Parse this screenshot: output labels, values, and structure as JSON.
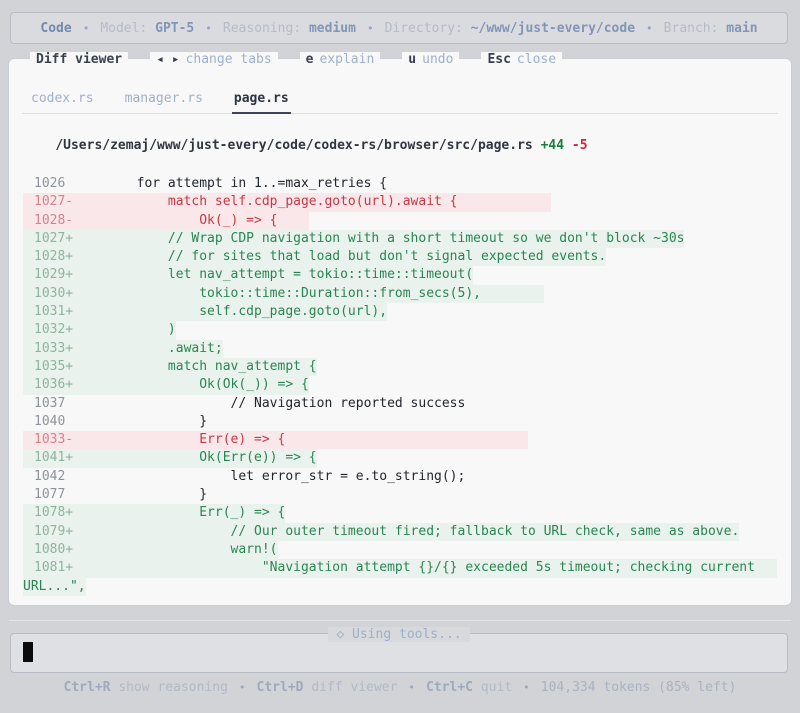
{
  "topbar": {
    "app": "Code",
    "separator": "•",
    "items": [
      {
        "label": "Model: ",
        "value": "GPT-5"
      },
      {
        "label": "Reasoning: ",
        "value": "medium"
      },
      {
        "label": "Directory: ",
        "value": "~/www/just-every/code"
      },
      {
        "label": "Branch: ",
        "value": "main"
      }
    ]
  },
  "diff_viewer": {
    "title": "Diff viewer",
    "shortcuts": [
      {
        "key": "◂ ▸",
        "action": "change tabs"
      },
      {
        "key": "e",
        "action": "explain"
      },
      {
        "key": "u",
        "action": "undo"
      },
      {
        "key": "Esc",
        "action": "close"
      }
    ],
    "tabs": [
      {
        "label": "codex.rs",
        "active": false
      },
      {
        "label": "manager.rs",
        "active": false
      },
      {
        "label": "page.rs",
        "active": true
      }
    ],
    "file": {
      "path": "/Users/zemaj/www/just-every/code/codex-rs/browser/src/page.rs",
      "additions": "+44",
      "deletions": "-5"
    },
    "lines": [
      {
        "num": "1026",
        "type": "context",
        "text": "        for attempt in 1..=max_retries {"
      },
      {
        "num": "1027-",
        "type": "removed",
        "text": "            match self.cdp_page.goto(url).await {            "
      },
      {
        "num": "1028-",
        "type": "removed",
        "text": "                Ok(_) => {    "
      },
      {
        "num": "1027+",
        "type": "added",
        "text": "            // Wrap CDP navigation with a short timeout so we don't block ~30s"
      },
      {
        "num": "1028+",
        "type": "added",
        "text": "            // for sites that load but don't signal expected events."
      },
      {
        "num": "1029+",
        "type": "added",
        "text": "            let nav_attempt = tokio::time::timeout("
      },
      {
        "num": "1030+",
        "type": "added",
        "text": "                tokio::time::Duration::from_secs(5),        "
      },
      {
        "num": "1031+",
        "type": "added",
        "text": "                self.cdp_page.goto(url),"
      },
      {
        "num": "1032+",
        "type": "added",
        "text": "            )"
      },
      {
        "num": "1033+",
        "type": "added",
        "text": "            .await;"
      },
      {
        "num": "1035+",
        "type": "added",
        "text": "            match nav_attempt {"
      },
      {
        "num": "1036+",
        "type": "added",
        "text": "                Ok(Ok(_)) => {"
      },
      {
        "num": "1037",
        "type": "context",
        "text": "                    // Navigation reported success"
      },
      {
        "num": "1040",
        "type": "context",
        "text": "                }"
      },
      {
        "num": "1033-",
        "type": "removed",
        "text": "                Err(e) => {                               "
      },
      {
        "num": "1041+",
        "type": "added",
        "text": "                Ok(Err(e)) => {"
      },
      {
        "num": "1042",
        "type": "context",
        "text": "                    let error_str = e.to_string();"
      },
      {
        "num": "1077",
        "type": "context",
        "text": "                }"
      },
      {
        "num": "1078+",
        "type": "added",
        "text": "                Err(_) => {"
      },
      {
        "num": "1079+",
        "type": "added",
        "text": "                    // Our outer timeout fired; fallback to URL check, same as above."
      },
      {
        "num": "1080+",
        "type": "added",
        "text": "                    warn!("
      },
      {
        "num": "1081+",
        "type": "added",
        "text": "                        \"Navigation attempt {}/{} exceeded 5s timeout; checking current",
        "wide": true
      },
      {
        "num": "",
        "type": "added",
        "text": "URL...\",",
        "wrap": true
      }
    ]
  },
  "status": {
    "legend_icon": "◇",
    "legend": "Using tools..."
  },
  "footer": {
    "separator": "•",
    "shortcuts": [
      {
        "key": "Ctrl+R",
        "action": " show reasoning"
      },
      {
        "key": "Ctrl+D",
        "action": " diff viewer"
      },
      {
        "key": "Ctrl+C",
        "action": " quit"
      }
    ],
    "tokens": "104,334 tokens (85% left)"
  },
  "colors": {
    "page_bg": "#d2d3d6",
    "modal_bg": "#f8f8f9",
    "added_bg": "#e9f2ec",
    "added_text": "#2b8552",
    "removed_bg": "#fae7e9",
    "removed_text": "#c73847",
    "accent_dim_blue": "#9fb0ca",
    "cursor": "#0b0b0b"
  }
}
